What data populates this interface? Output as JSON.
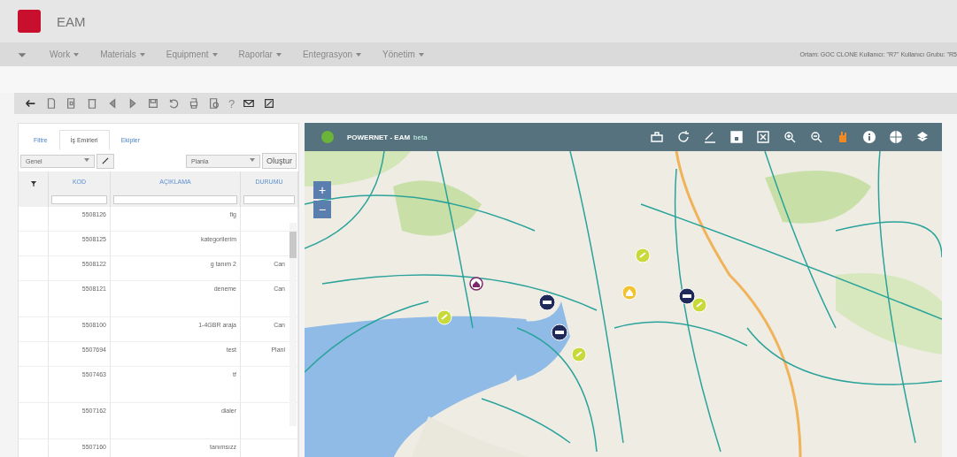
{
  "app": {
    "title": "EAM"
  },
  "nav": {
    "items": [
      {
        "label": "Work"
      },
      {
        "label": "Materials"
      },
      {
        "label": "Equipment"
      },
      {
        "label": "Raporlar"
      },
      {
        "label": "Entegrasyon"
      },
      {
        "label": "Yönetim"
      }
    ],
    "session": "Ortam: GOC CLONE Kullanıcı: \"R7\" Kullanıcı Grubu: \"R5"
  },
  "toolbar": {
    "help": "?"
  },
  "panel": {
    "tabs": [
      {
        "label": "Filtre",
        "selected": false
      },
      {
        "label": "İş Emirleri",
        "selected": true
      },
      {
        "label": "Ekipler",
        "selected": false
      }
    ],
    "view_select": "Genel",
    "action_select": "Planla",
    "create_button": "Oluştur",
    "columns": [
      "KOD",
      "AÇIKLAMA",
      "DURUMU"
    ],
    "rows": [
      {
        "code": "5508126",
        "description": "fig",
        "tall": false
      },
      {
        "code": "5508125",
        "description": "kategorilerim",
        "tall": false
      },
      {
        "code": "5508122",
        "description": "g tanım 2",
        "status": "Can",
        "tall": false
      },
      {
        "code": "5508121",
        "description": "deneme",
        "status": "Can",
        "tall": true
      },
      {
        "code": "5508100",
        "description": "1-4GBR araja",
        "status": "Can",
        "tall": false
      },
      {
        "code": "5507694",
        "description": "test",
        "status": "Planl",
        "tall": false
      },
      {
        "code": "5507463",
        "description": "tf",
        "tall": true
      },
      {
        "code": "5507162",
        "description": "dialer",
        "tall": true
      },
      {
        "code": "5507160",
        "description": "tanımsızz",
        "tall": true
      }
    ]
  },
  "map": {
    "title": "POWERNET - EAM",
    "subtitle": "beta",
    "zoom_in": "+",
    "zoom_out": "−",
    "markers": [
      {
        "kind": "bulb"
      },
      {
        "kind": "home"
      },
      {
        "kind": "bulb"
      },
      {
        "kind": "bulb"
      },
      {
        "kind": "bulb"
      },
      {
        "kind": "vehicle"
      },
      {
        "kind": "vehicle"
      },
      {
        "kind": "vehicle"
      },
      {
        "kind": "site"
      }
    ]
  }
}
